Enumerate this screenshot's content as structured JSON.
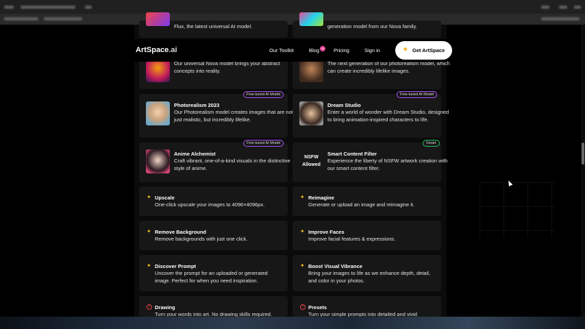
{
  "nav": {
    "logo_main": "ArtSpace",
    "logo_suffix": ".ai",
    "links": [
      "Our Toolkit",
      "Blog",
      "Pricing",
      "Sign in"
    ],
    "blog_badge": "44",
    "cta_label": "Get ArtSpace"
  },
  "cards": {
    "flux": {
      "desc": "Flux, the latest universal AI model."
    },
    "nova_top": {
      "desc": "generation model from our Nova family."
    },
    "nova_universal": {
      "desc": "Our universal Nova model brings your abstract concepts into reality."
    },
    "nova_next": {
      "desc": "The next generation of our photorealism model, which can create incredibly lifelike images."
    },
    "photorealism": {
      "title": "Photorealism 2023",
      "badge": "Fine-tuned AI Model",
      "desc": "Our Photorealism model creates images that are not just realistic, but incredibly lifelike."
    },
    "dream": {
      "title": "Dream Studio",
      "badge": "Fine-tuned AI Model",
      "desc": "Enter a world of wonder with Dream Studio, designed to bring animation-inspired characters to life."
    },
    "anime": {
      "title": "Anime Alchemist",
      "badge": "Fine-tuned AI Model",
      "desc": "Craft vibrant, one-of-a-kind visuals in the distinctive style of anime."
    },
    "smart": {
      "title": "Smart Content Filter",
      "badge": "Smart",
      "nsfw_line1": "NSFW",
      "nsfw_line2": "Allowed",
      "desc": "Experience the liberty of NSFW artwork creation with our smart content filter."
    },
    "upscale": {
      "title": "Upscale",
      "desc": "One-click upscale your images to 4096×4096px."
    },
    "reimagine": {
      "title": "Reimagine",
      "desc": "Generate or upload an image and reimagine it."
    },
    "remove_bg": {
      "title": "Remove Background",
      "desc": "Remove backgrounds with just one click."
    },
    "faces": {
      "title": "Improve Faces",
      "desc": "Improve facial features & expressions."
    },
    "discover": {
      "title": "Discover Prompt",
      "desc": "Uncover the prompt for an uploaded or generated image. Perfect for when you need inspiration."
    },
    "vibrance": {
      "title": "Boost Visual Vibrance",
      "desc": "Bring your images to life as we enhance depth, detail, and color in your photos."
    },
    "drawing": {
      "title": "Drawing",
      "desc": "Turn your words into art. No drawing skills required."
    },
    "presets": {
      "title": "Presets",
      "desc": "Turn your simple prompts into detailed and vivid"
    }
  },
  "icons": {
    "wand": "magic-wand-icon",
    "alert": "alert-circle-icon",
    "sparkle": "sparkle-icon"
  },
  "colors": {
    "badge_purple": "#a855f7",
    "badge_green": "#22c55e",
    "wand_yellow": "#f5c518",
    "alert_red": "#ef4444"
  }
}
